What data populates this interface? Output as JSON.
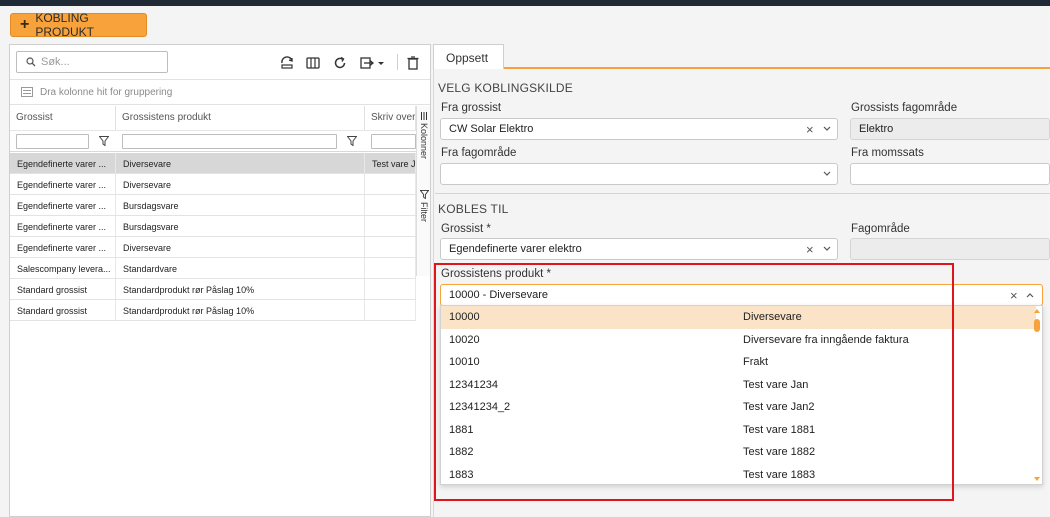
{
  "header": {
    "add_button_label": "KOBLING PRODUKT"
  },
  "left": {
    "search": {
      "placeholder": "Søk..."
    },
    "group_hint": "Dra kolonne hit for gruppering",
    "columns": [
      "Grossist",
      "Grossistens produkt",
      "Skriv over v"
    ],
    "side_tabs": {
      "columns": "Kolonner",
      "filter": "Filter"
    },
    "rows": [
      {
        "grossist": "Egendefinerte varer ...",
        "produkt": "Diversevare",
        "skriv": "Test vare Ja"
      },
      {
        "grossist": "Egendefinerte varer ...",
        "produkt": "Diversevare",
        "skriv": ""
      },
      {
        "grossist": "Egendefinerte varer ...",
        "produkt": "Bursdagsvare",
        "skriv": ""
      },
      {
        "grossist": "Egendefinerte varer ...",
        "produkt": "Bursdagsvare",
        "skriv": ""
      },
      {
        "grossist": "Egendefinerte varer ...",
        "produkt": "Diversevare",
        "skriv": ""
      },
      {
        "grossist": "Salescompany levera...",
        "produkt": "Standardvare",
        "skriv": ""
      },
      {
        "grossist": "Standard grossist",
        "produkt": "Standardprodukt rør Påslag 10%",
        "skriv": ""
      },
      {
        "grossist": "Standard grossist",
        "produkt": "Standardprodukt rør Påslag 10%",
        "skriv": ""
      }
    ]
  },
  "right": {
    "tab_label": "Oppsett",
    "source_section": {
      "title": "VELG KOBLINGSKILDE",
      "fra_grossist_label": "Fra grossist",
      "fra_grossist_value": "CW Solar Elektro",
      "grossists_fagomrade_label": "Grossists fagområde",
      "grossists_fagomrade_value": "Elektro",
      "fra_fagomrade_label": "Fra fagområde",
      "fra_fagomrade_value": "",
      "fra_momssats_label": "Fra momssats",
      "fra_momssats_value": ""
    },
    "target_section": {
      "title": "KOBLES TIL",
      "grossist_label": "Grossist *",
      "grossist_value": "Egendefinerte varer elektro",
      "fagomrade_label": "Fagområde",
      "fagomrade_value": "",
      "produkt_label": "Grossistens produkt *",
      "produkt_value": "10000 - Diversevare"
    },
    "dropdown_options": [
      {
        "code": "10000",
        "name": "Diversevare"
      },
      {
        "code": "10020",
        "name": "Diversevare fra inngående faktura"
      },
      {
        "code": "10010",
        "name": "Frakt"
      },
      {
        "code": "12341234",
        "name": "Test vare Jan"
      },
      {
        "code": "12341234_2",
        "name": "Test vare Jan2"
      },
      {
        "code": "1881",
        "name": "Test vare 1881"
      },
      {
        "code": "1882",
        "name": "Test vare 1882"
      },
      {
        "code": "1883",
        "name": "Test vare 1883"
      }
    ]
  },
  "colors": {
    "accent": "#f7a23b",
    "highlight": "#e0151b",
    "selected_row": "#d7d7d7",
    "dropdown_active": "#fbe3c7"
  }
}
